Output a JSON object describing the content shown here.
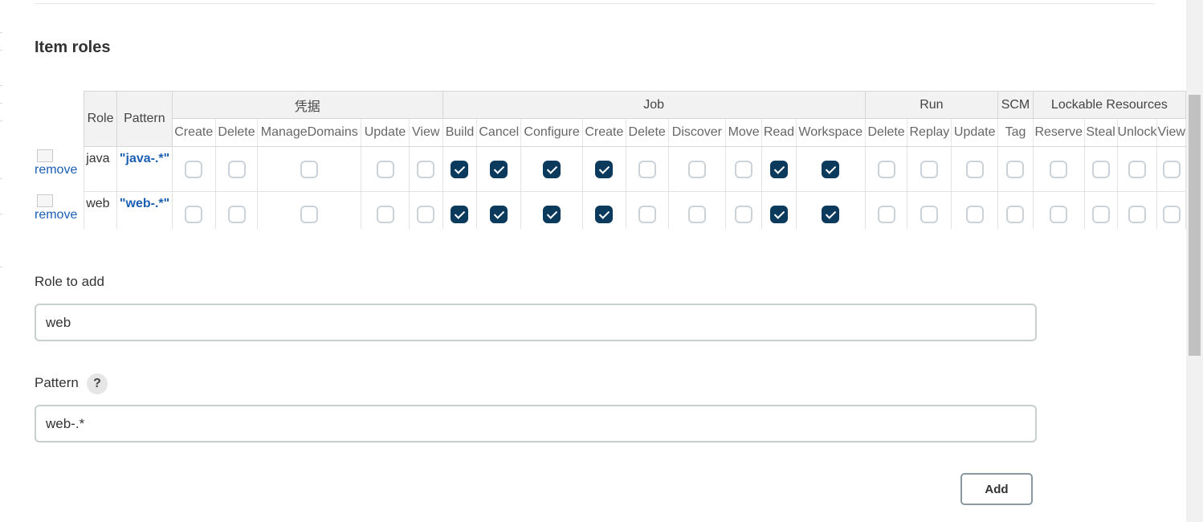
{
  "section_title": "Item roles",
  "table": {
    "role_header": "Role",
    "pattern_header": "Pattern",
    "groups": [
      {
        "name": "凭据",
        "perms": [
          "Create",
          "Delete",
          "ManageDomains",
          "Update",
          "View"
        ]
      },
      {
        "name": "Job",
        "perms": [
          "Build",
          "Cancel",
          "Configure",
          "Create",
          "Delete",
          "Discover",
          "Move",
          "Read",
          "Workspace"
        ]
      },
      {
        "name": "Run",
        "perms": [
          "Delete",
          "Replay",
          "Update"
        ]
      },
      {
        "name": "SCM",
        "perms": [
          "Tag"
        ]
      },
      {
        "name": "Lockable Resources",
        "perms": [
          "Reserve",
          "Steal",
          "Unlock",
          "View"
        ]
      }
    ],
    "rows": [
      {
        "remove_alt": "remove",
        "role": "java",
        "pattern": "\"java-.*\"",
        "checks": [
          false,
          false,
          false,
          false,
          false,
          true,
          true,
          true,
          true,
          false,
          false,
          false,
          true,
          true,
          false,
          false,
          false,
          false,
          false,
          false,
          false,
          false
        ]
      },
      {
        "remove_alt": "remove",
        "role": "web",
        "pattern": "\"web-.*\"",
        "checks": [
          false,
          false,
          false,
          false,
          false,
          true,
          true,
          true,
          true,
          false,
          false,
          false,
          true,
          true,
          false,
          false,
          false,
          false,
          false,
          false,
          false,
          false
        ]
      }
    ]
  },
  "role_to_add": {
    "label": "Role to add",
    "value": "web"
  },
  "pattern_field": {
    "label": "Pattern",
    "help_label": "?",
    "value": "web-.*"
  },
  "add_button_label": "Add",
  "colors": {
    "checked": "#0b3a5d",
    "link": "#1a5fb4",
    "header_bg": "#f2f2f2"
  }
}
